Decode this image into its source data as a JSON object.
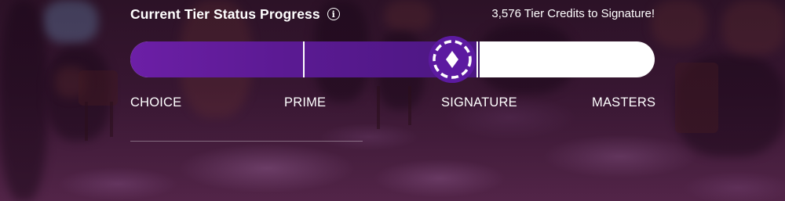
{
  "widget": {
    "title": "Current Tier Status Progress",
    "info_icon": "info-icon",
    "credits_message": "3,576 Tier Credits to Signature!"
  },
  "progress": {
    "fraction": 0.66,
    "current_marker_icon": "diamond-chip-icon",
    "tiers": [
      {
        "label": "CHOICE"
      },
      {
        "label": "PRIME"
      },
      {
        "label": "SIGNATURE"
      },
      {
        "label": "MASTERS"
      }
    ]
  },
  "colors": {
    "fill": "#5b1a93",
    "track": "#ffffff",
    "chip": "#5c1aa0",
    "text": "#ffffff"
  }
}
